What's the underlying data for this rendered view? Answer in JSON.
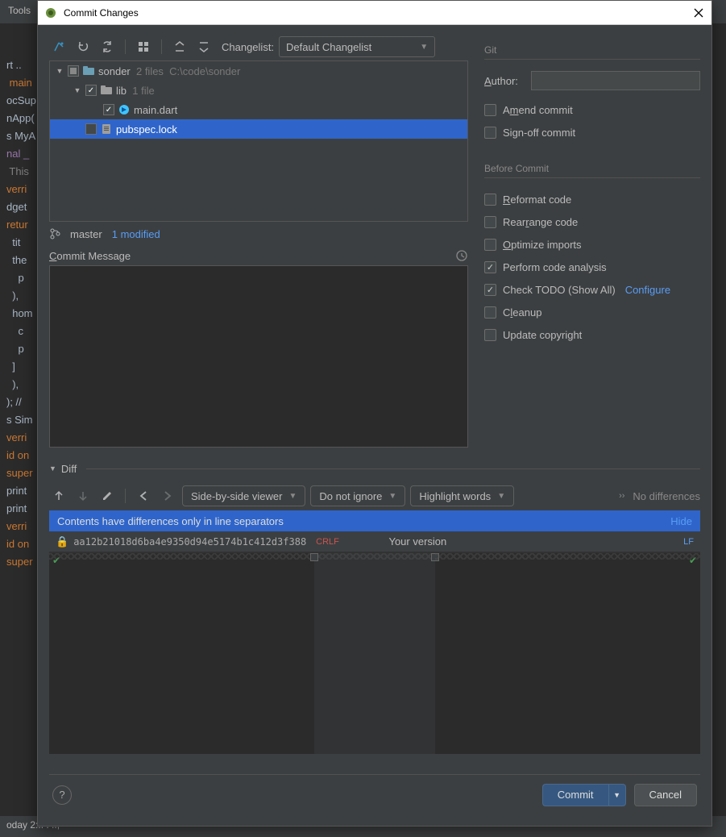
{
  "bg": {
    "menu": "Tools",
    "lines": [
      {
        "text": "rt ..",
        "cls": ""
      },
      {
        "text": "",
        "cls": ""
      },
      {
        "text": " main",
        "cls": "k-orange"
      },
      {
        "text": "ocSup",
        "cls": ""
      },
      {
        "text": "nApp(",
        "cls": ""
      },
      {
        "text": "",
        "cls": ""
      },
      {
        "text": "",
        "cls": ""
      },
      {
        "text": "s MyA",
        "cls": ""
      },
      {
        "text": "nal _",
        "cls": "k-purple"
      },
      {
        "text": " This",
        "cls": "k-gray"
      },
      {
        "text": "verri",
        "cls": "k-orange"
      },
      {
        "text": "dget ",
        "cls": ""
      },
      {
        "text": "retur",
        "cls": "k-orange"
      },
      {
        "text": "  tit",
        "cls": ""
      },
      {
        "text": "  the",
        "cls": ""
      },
      {
        "text": "    p",
        "cls": ""
      },
      {
        "text": "  ),",
        "cls": ""
      },
      {
        "text": "  hom",
        "cls": ""
      },
      {
        "text": "    c",
        "cls": ""
      },
      {
        "text": "    p",
        "cls": ""
      },
      {
        "text": "",
        "cls": ""
      },
      {
        "text": "",
        "cls": ""
      },
      {
        "text": "  ]",
        "cls": ""
      },
      {
        "text": "",
        "cls": ""
      },
      {
        "text": "  ),",
        "cls": ""
      },
      {
        "text": "); //",
        "cls": ""
      },
      {
        "text": "",
        "cls": ""
      },
      {
        "text": "",
        "cls": ""
      },
      {
        "text": "",
        "cls": ""
      },
      {
        "text": "s Sim",
        "cls": ""
      },
      {
        "text": "verri",
        "cls": "k-orange"
      },
      {
        "text": "id on",
        "cls": "k-orange"
      },
      {
        "text": "super",
        "cls": "k-orange"
      },
      {
        "text": "print",
        "cls": ""
      },
      {
        "text": "print",
        "cls": ""
      },
      {
        "text": "",
        "cls": ""
      },
      {
        "text": "",
        "cls": ""
      },
      {
        "text": "verri",
        "cls": "k-orange"
      },
      {
        "text": "id on",
        "cls": "k-orange"
      },
      {
        "text": "super",
        "cls": "k-orange"
      }
    ],
    "status": "oday 2:.. . ..,"
  },
  "dialog": {
    "title": "Commit Changes",
    "close_tooltip": "Close"
  },
  "toolbar": {
    "changelist_label": "Changelist:",
    "changelist_value": "Default Changelist"
  },
  "tree": {
    "rows": [
      {
        "indent": 0,
        "arrow": "▼",
        "check": "partial",
        "icon": "folder-blue",
        "label": "sonder",
        "meta": "  2 files  C:\\code\\sonder",
        "sel": false
      },
      {
        "indent": 1,
        "arrow": "▼",
        "check": "checked",
        "icon": "folder",
        "label": "lib",
        "meta": "  1 file",
        "sel": false
      },
      {
        "indent": 2,
        "arrow": "",
        "check": "checked",
        "icon": "dart",
        "label": "main.dart",
        "meta": "",
        "sel": false
      },
      {
        "indent": 1,
        "arrow": "",
        "check": "empty",
        "icon": "file",
        "label": "pubspec.lock",
        "meta": "",
        "sel": true
      }
    ]
  },
  "branch": {
    "name": "master",
    "modified": "1 modified"
  },
  "commit_message": {
    "label": "Commit Message",
    "value": ""
  },
  "git": {
    "section": "Git",
    "author_label": "Author:",
    "author_value": "",
    "amend": "Amend commit",
    "signoff": "Sign-off commit"
  },
  "before": {
    "section": "Before Commit",
    "items": [
      {
        "key": "reformat",
        "label": "Reformat code",
        "checked": false,
        "u": 0
      },
      {
        "key": "rearrange",
        "label": "Rearrange code",
        "checked": false,
        "u": 4
      },
      {
        "key": "optimize",
        "label": "Optimize imports",
        "checked": false,
        "u": 0
      },
      {
        "key": "analysis",
        "label": "Perform code analysis",
        "checked": true,
        "u": -1
      },
      {
        "key": "todo",
        "label": "Check TODO (Show All)",
        "checked": true,
        "u": -1,
        "link": "Configure"
      },
      {
        "key": "cleanup",
        "label": "Cleanup",
        "checked": false,
        "u": 1
      },
      {
        "key": "copyright",
        "label": "Update copyright",
        "checked": false,
        "u": -1
      }
    ]
  },
  "diff": {
    "label": "Diff",
    "viewer": "Side-by-side viewer",
    "ignore": "Do not ignore",
    "highlight": "Highlight words",
    "nodiff": "No differences",
    "banner": "Contents have differences only in line separators",
    "hide": "Hide",
    "hash": "aa12b21018d6ba4e9350d94e5174b1c412d3f388",
    "crlf": "CRLF",
    "your": "Your version",
    "lf": "LF"
  },
  "buttons": {
    "commit": "Commit",
    "cancel": "Cancel"
  }
}
